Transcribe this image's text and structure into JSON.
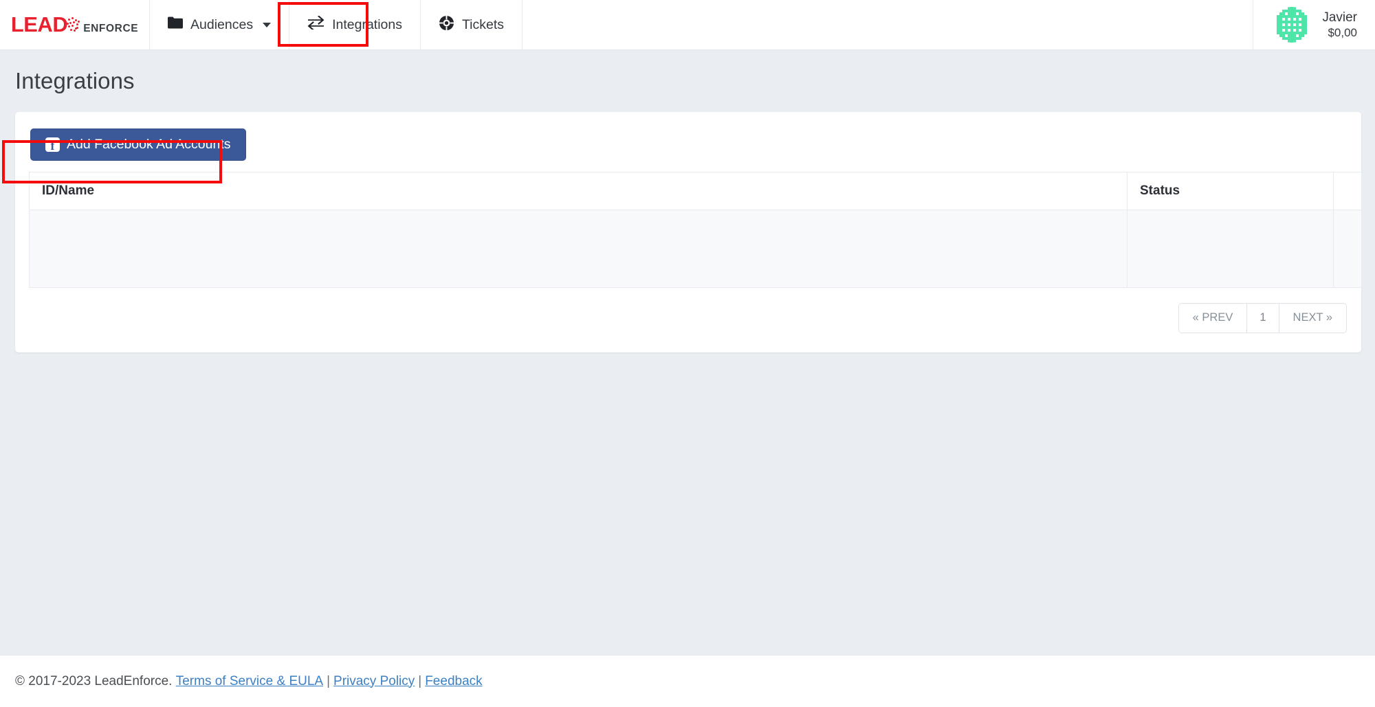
{
  "navbar": {
    "brand": {
      "lead": "LEAD",
      "enforce": "ENFORCE"
    },
    "items": [
      {
        "label": "Audiences",
        "icon": "folder-icon",
        "has_caret": true
      },
      {
        "label": "Integrations",
        "icon": "exchange-arrows-icon",
        "has_caret": false
      },
      {
        "label": "Tickets",
        "icon": "life-ring-icon",
        "has_caret": false
      }
    ],
    "user": {
      "name": "Javier",
      "balance": "$0,00",
      "avatar": "identicon-avatar"
    }
  },
  "main": {
    "page_title": "Integrations",
    "toolbar": {
      "add_facebook_label": "Add Facebook Ad Accounts",
      "facebook_icon": "facebook-f-icon",
      "button_color": "#3b5998"
    },
    "table": {
      "columns": [
        "ID/Name",
        "Status",
        ""
      ],
      "rows": [
        {
          "id_name": "",
          "status": "",
          "actions": ""
        }
      ]
    },
    "pagination": {
      "prev_label": "« PREV",
      "pages": [
        "1"
      ],
      "next_label": "NEXT »"
    }
  },
  "footer": {
    "copyright": "© 2017-2023 LeadEnforce.",
    "links": [
      "Terms of Service & EULA",
      "Privacy Policy",
      "Feedback"
    ],
    "separator": "|"
  },
  "highlights": {
    "accent_color": "#f40c0c",
    "boxes": [
      "integrations-nav-highlight",
      "add-facebook-button-highlight"
    ]
  }
}
